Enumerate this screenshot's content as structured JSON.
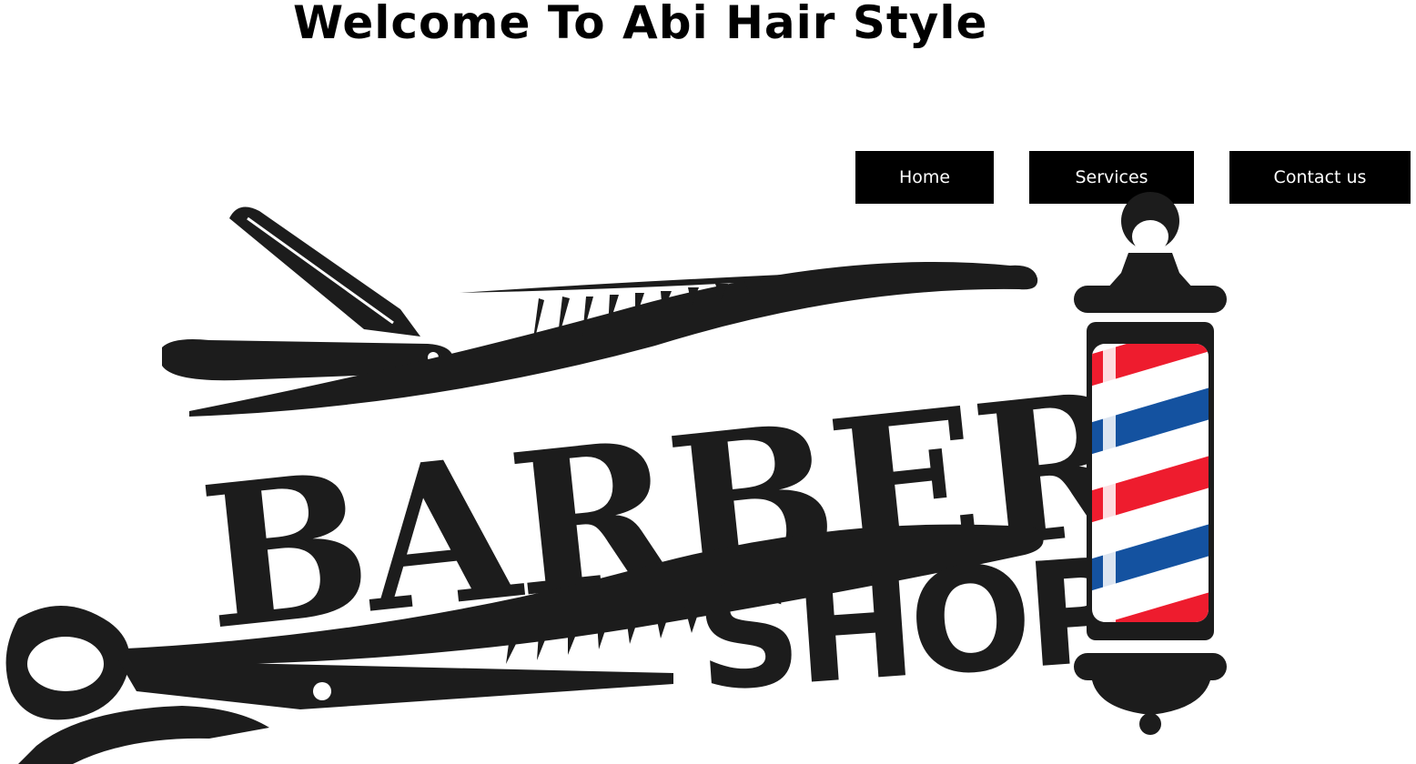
{
  "header": {
    "title": "Welcome To Abi Hair Style"
  },
  "nav": {
    "items": [
      {
        "label": "Home"
      },
      {
        "label": "Services"
      },
      {
        "label": "Contact us"
      }
    ]
  },
  "logo": {
    "line1": "BARBER",
    "line2": "SHOP",
    "colors": {
      "ink": "#1c1c1c",
      "red": "#ee1c2e",
      "blue": "#1452a0"
    }
  }
}
